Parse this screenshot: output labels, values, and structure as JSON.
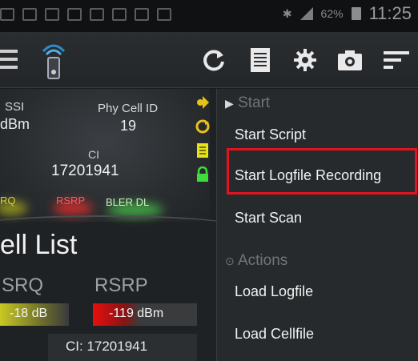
{
  "status_bar": {
    "battery_percent": "62%",
    "clock": "11:25",
    "icons": [
      "notification-icon",
      "mail-icon",
      "gallery-icon",
      "mail-icon",
      "calendar-icon",
      "calendar-icon",
      "calendar-icon",
      "calendar-icon",
      "bluetooth-icon",
      "signal-icon",
      "battery-icon"
    ]
  },
  "toolbar": {
    "icons": [
      "menu-icon",
      "app-logo-icon",
      "refresh-icon",
      "list-icon",
      "gear-icon",
      "camera-icon",
      "filter-icon"
    ]
  },
  "kpi_panel": {
    "ssi_label": "SSI",
    "ssi_value": "dBm",
    "phy_cell_id_label": "Phy Cell ID",
    "phy_cell_id_value": "19",
    "ci_label": "CI",
    "ci_value": "17201941",
    "indicators": [
      "RQ",
      "RSRP",
      "BLER DL"
    ]
  },
  "cell_list": {
    "title": "ell List",
    "columns": [
      "SRQ",
      "RSRP"
    ],
    "rsrq_value": "-18 dB",
    "rsrp_value": "-119 dBm",
    "ci_text": "CI: 17201941"
  },
  "menu": {
    "section_start": "Start",
    "section_actions": "Actions",
    "items": [
      "Start Script",
      "Start Logfile Recording",
      "Start Scan",
      "Load Logfile",
      "Load Cellfile"
    ],
    "highlighted_item": "Start Logfile Recording"
  },
  "colors": {
    "highlight": "#e0141e",
    "rsrq_bar": "#c8c923",
    "rsrp_bar": "#e80f0f"
  }
}
